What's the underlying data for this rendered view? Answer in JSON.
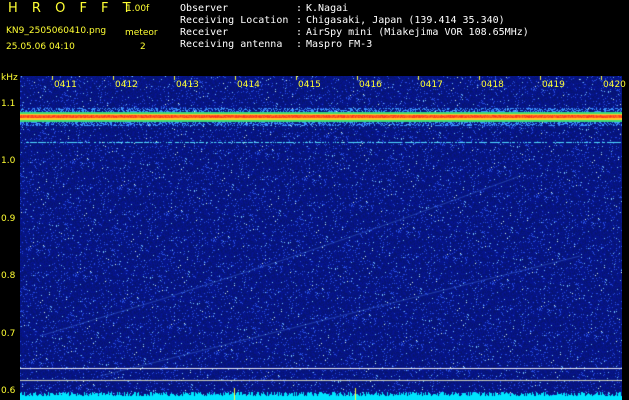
{
  "header": {
    "app_title": "H R O F F T",
    "version": "1.00f",
    "filename": "KN9_2505060410.png",
    "datetime": "25.05.06 04:10",
    "mode_label": "meteor",
    "mode_value": "2"
  },
  "info": [
    {
      "label": "Observer",
      "value": "K.Nagai"
    },
    {
      "label": "Receiving Location",
      "value": "Chigasaki, Japan (139.414 35.340)"
    },
    {
      "label": "Receiver",
      "value": "AirSpy mini (Miakejima VOR 108.65MHz)"
    },
    {
      "label": "Receiving antenna",
      "value": "Maspro FM-3"
    }
  ],
  "spectrogram": {
    "unit": "kHz",
    "y_ticks": [
      "1.1",
      "1.0",
      "0.9",
      "0.8",
      "0.7",
      "0.6"
    ],
    "x_ticks": [
      "0411",
      "0412",
      "0413",
      "0414",
      "0415",
      "0416",
      "0417",
      "0418",
      "0419",
      "0420"
    ],
    "y_range_khz": [
      0.6,
      1.15
    ],
    "carrier_khz": 1.08,
    "secondary_line_khz": 1.035,
    "colors": {
      "background": "#000000",
      "noise_base": "#0a1a7a",
      "carrier": "#ff3030",
      "axis_text": "#ffff33",
      "info_text": "#ffffff",
      "level_trace": "#00e5ff"
    }
  }
}
